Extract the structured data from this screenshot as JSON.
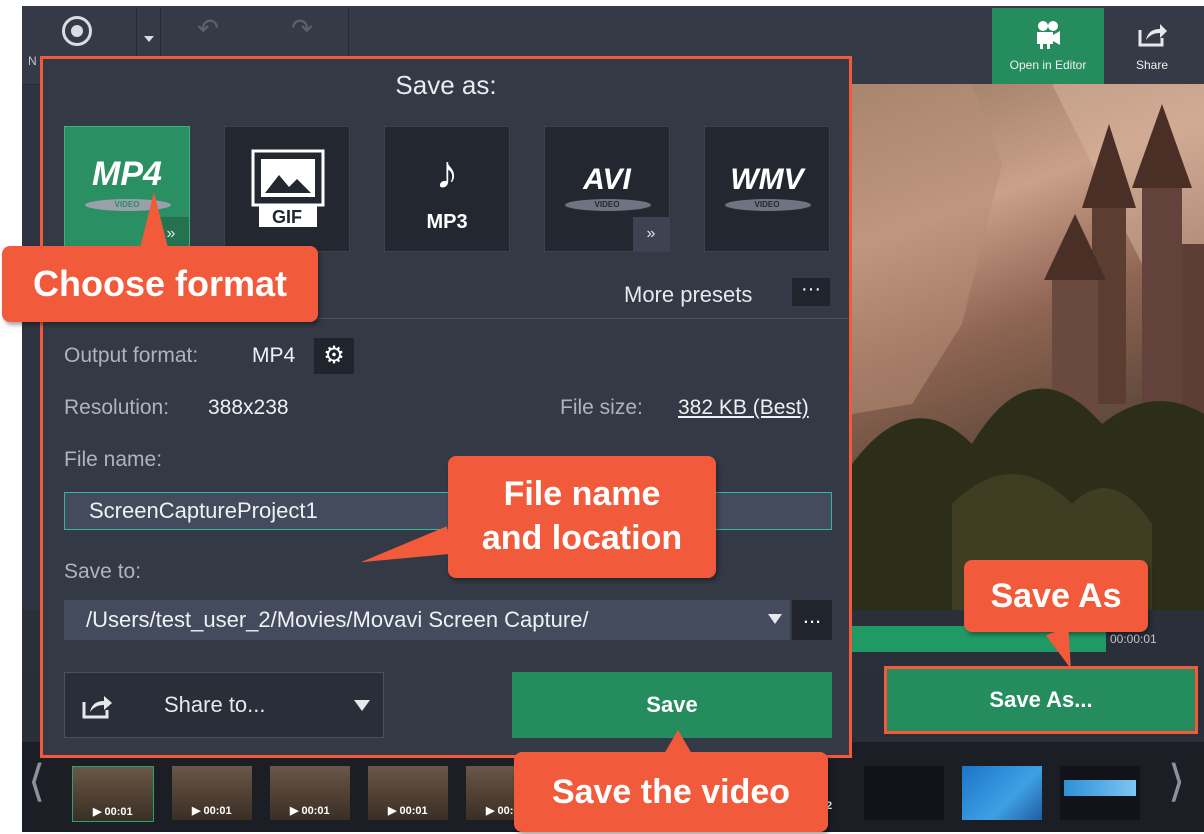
{
  "toolbar": {
    "open_in_editor_label": "Open in Editor",
    "share_label": "Share",
    "record_partial_label": "N"
  },
  "preview": {
    "time_end": "00:00:01",
    "save_as_button": "Save As..."
  },
  "filmstrip": {
    "thumbs": [
      "00:01",
      "00:01",
      "00:01",
      "00:01",
      "00:01"
    ],
    "partial_label": "2"
  },
  "dialog": {
    "title": "Save as:",
    "formats": [
      {
        "id": "mp4",
        "label": "MP4",
        "subtitle": "VIDEO",
        "selected": true
      },
      {
        "id": "gif",
        "label": "GIF",
        "selected": false
      },
      {
        "id": "mp3",
        "label": "MP3",
        "selected": false
      },
      {
        "id": "avi",
        "label": "AVI",
        "subtitle": "VIDEO",
        "selected": false
      },
      {
        "id": "wmv",
        "label": "WMV",
        "subtitle": "VIDEO",
        "selected": false
      }
    ],
    "more_presets_label": "More presets",
    "more_presets_btn": "···",
    "output_format_label": "Output format:",
    "output_format_value": "MP4",
    "resolution_label": "Resolution:",
    "resolution_value": "388x238",
    "file_size_label": "File size:",
    "file_size_value": "382 KB (Best)",
    "file_name_label": "File name:",
    "file_name_value": "ScreenCaptureProject1",
    "save_to_label": "Save to:",
    "save_to_value": "/Users/test_user_2/Movies/Movavi Screen Capture/",
    "browse_btn": "...",
    "share_to_label": "Share to...",
    "save_button": "Save"
  },
  "callouts": {
    "choose_format": "Choose format",
    "file_name_line1": "File name",
    "file_name_line2": "and location",
    "save_as": "Save As",
    "save_video": "Save the video"
  },
  "colors": {
    "accent_green": "#258c5e",
    "callout_orange": "#f15a3a",
    "dialog_bg": "#343946"
  }
}
